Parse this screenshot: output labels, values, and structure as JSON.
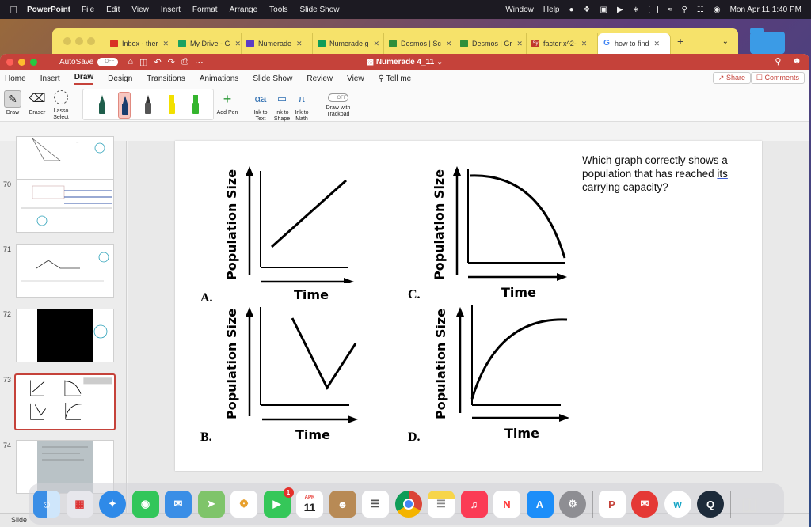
{
  "menubar": {
    "app": "PowerPoint",
    "items": [
      "File",
      "Edit",
      "View",
      "Insert",
      "Format",
      "Arrange",
      "Tools",
      "Slide Show",
      "Window",
      "Help"
    ],
    "clock": "Mon Apr 11  1:40 PM"
  },
  "browser": {
    "tabs": [
      {
        "label": "Inbox - ther",
        "color": "#d93025"
      },
      {
        "label": "My Drive - G",
        "color": "#1aa260"
      },
      {
        "label": "Numerade",
        "color": "#5b3cc4"
      },
      {
        "label": "Numerade g",
        "color": "#0f9d58"
      },
      {
        "label": "Desmos | Sc",
        "color": "#2f8f3a"
      },
      {
        "label": "Desmos | Gr",
        "color": "#2f8f3a"
      },
      {
        "label": "factor x^2-",
        "color": "#c0392b",
        "icon_text": "Sy"
      },
      {
        "label": "how to find",
        "color": "#4285f4",
        "icon_text": "G",
        "active": true
      }
    ]
  },
  "window": {
    "autosave_label": "AutoSave",
    "autosave_state": "OFF",
    "doc_title": "Numerade 4_11"
  },
  "ribbon": {
    "tabs": [
      "Home",
      "Insert",
      "Draw",
      "Design",
      "Transitions",
      "Animations",
      "Slide Show",
      "Review",
      "View"
    ],
    "active_tab": "Draw",
    "tell_me": "Tell me",
    "share": "Share",
    "comments": "Comments",
    "tools": {
      "draw": "Draw",
      "eraser": "Eraser",
      "lasso": "Lasso Select",
      "add_pen": "Add Pen",
      "ink_text": "Ink to Text",
      "ink_shape": "Ink to Shape",
      "ink_math": "Ink to Math",
      "trackpad": "Draw with Trackpad",
      "trackpad_state": "OFF"
    },
    "pen_colors": [
      "#1f5e4b",
      "#1a3d6e",
      "#333333",
      "#f2e000",
      "#35b52e"
    ]
  },
  "slides": [
    {
      "num": "70"
    },
    {
      "num": "71"
    },
    {
      "num": "72"
    },
    {
      "num": "73",
      "selected": true
    },
    {
      "num": "74"
    }
  ],
  "status": {
    "text": "Slide"
  },
  "slide": {
    "question": "Which graph correctly shows a population that has reached its carrying capacity?",
    "question_parts": [
      "Which graph correctly shows a population that has reached ",
      "its",
      " carrying capacity?"
    ],
    "graphs": [
      {
        "letter": "A.",
        "ylabel": "Population Size",
        "xlabel": "Time",
        "shape": "linear increase"
      },
      {
        "letter": "B.",
        "ylabel": "Population Size",
        "xlabel": "Time",
        "shape": "decrease then increase"
      },
      {
        "letter": "C.",
        "ylabel": "Population Size",
        "xlabel": "Time",
        "shape": "decline"
      },
      {
        "letter": "D.",
        "ylabel": "Population Size",
        "xlabel": "Time",
        "shape": "rise then level off"
      }
    ]
  },
  "dock": {
    "calendar_month": "APR",
    "calendar_day": "11",
    "facetime_badge": "1",
    "apps": [
      "finder-icon",
      "launchpad-icon",
      "safari-icon",
      "messages-icon",
      "mail-icon",
      "maps-icon",
      "photos-icon",
      "facetime-icon",
      "calendar-icon",
      "contacts-icon",
      "reminders-icon",
      "chrome-icon",
      "notes-icon",
      "music-icon",
      "news-icon",
      "app-store-icon",
      "system-preferences-icon",
      "powerpoint-icon",
      "airmail-icon",
      "webex-icon",
      "quicktime-icon",
      "trash-icon"
    ]
  }
}
